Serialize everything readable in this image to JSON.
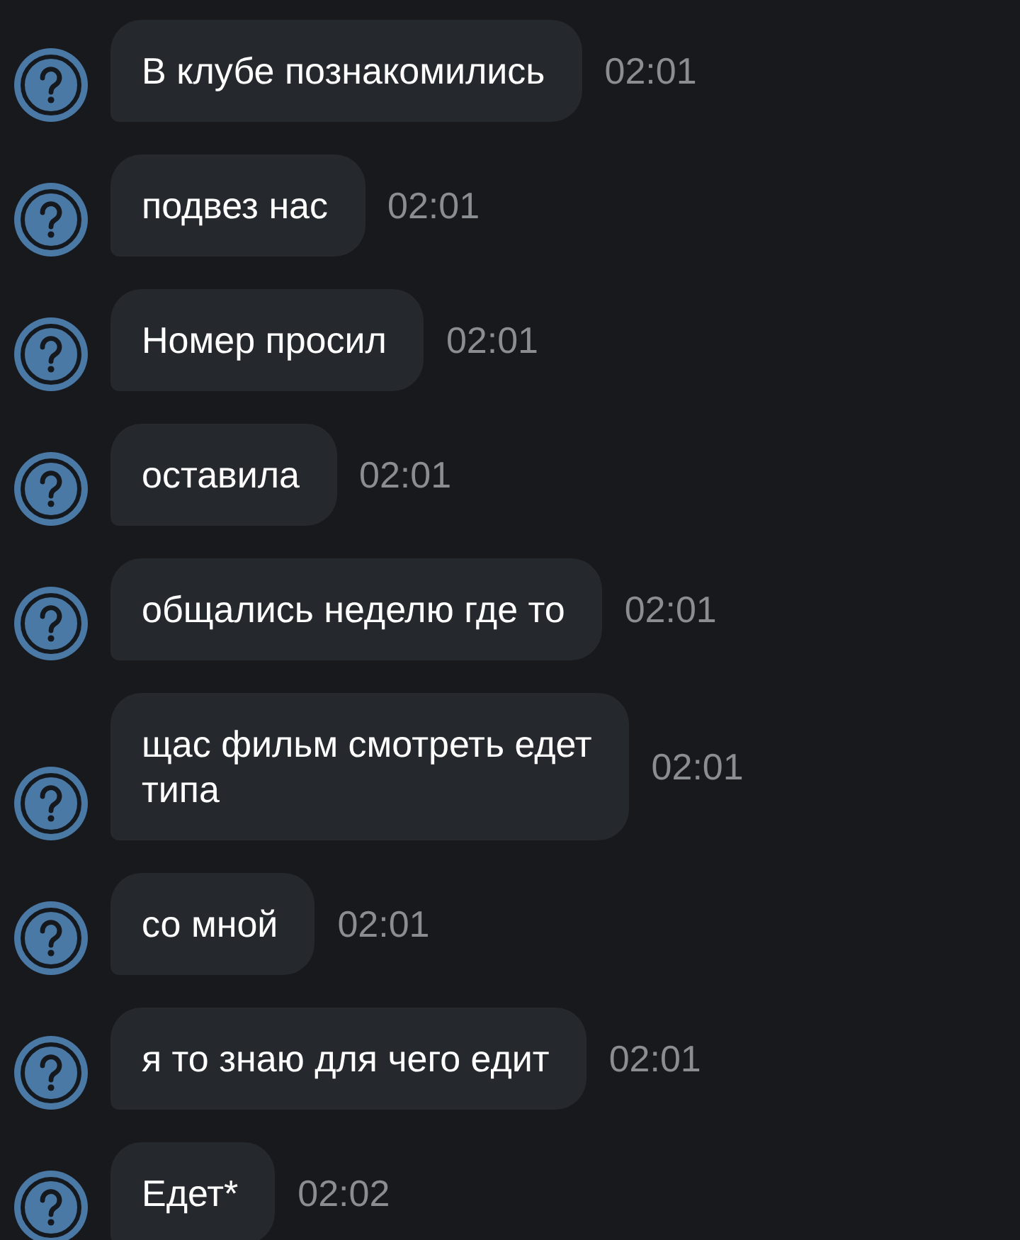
{
  "messages": [
    {
      "text": "В клубе познакомились",
      "time": "02:01"
    },
    {
      "text": "подвез нас",
      "time": "02:01"
    },
    {
      "text": "Номер просил",
      "time": "02:01"
    },
    {
      "text": "оставила",
      "time": "02:01"
    },
    {
      "text": "общались неделю где то",
      "time": "02:01"
    },
    {
      "text": "щас фильм смотреть едет\nтипа",
      "time": "02:01"
    },
    {
      "text": "со мной",
      "time": "02:01"
    },
    {
      "text": "я то знаю для чего едит",
      "time": "02:01"
    },
    {
      "text": "Едет*",
      "time": "02:02"
    }
  ]
}
